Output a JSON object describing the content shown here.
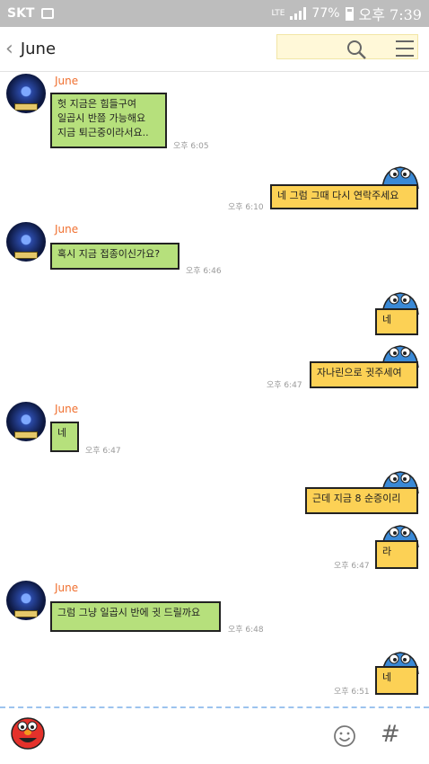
{
  "status_bar": {
    "carrier": "SKT",
    "network": "LTE",
    "battery": "77%",
    "time": "오후 7:39"
  },
  "header": {
    "back_icon": "chevron-left-icon",
    "title": "June",
    "search_icon": "search-icon",
    "menu_icon": "hamburger-menu-icon"
  },
  "messages": [
    {
      "sender": "June",
      "text": "헛 지금은 힘들구여\n일곱시 반쯤 가능해요\n지금 퇴근중이라서요..",
      "time": "오후 6:05"
    },
    {
      "text": "네 그럼 그때 다시 연락주세요",
      "time": "오후 6:10"
    },
    {
      "sender": "June",
      "text": "혹시 지금 접종이신가요?",
      "time": "오후 6:46"
    },
    {
      "text": "네",
      "time": ""
    },
    {
      "text": "자나린으로 귓주세여",
      "time": "오후 6:47"
    },
    {
      "sender": "June",
      "text": "네",
      "time": "오후 6:47"
    },
    {
      "text": "근데 지금 8 순증이리",
      "time": ""
    },
    {
      "text": "라",
      "time": "오후 6:47"
    },
    {
      "sender": "June",
      "text": "그럼 그냥 일곱시 반에 귓 드릴까요",
      "time": "오후 6:48"
    },
    {
      "text": "네",
      "time": "오후 6:51"
    }
  ],
  "colors": {
    "incoming_bubble": "#b6e07c",
    "outgoing_bubble": "#fcd155",
    "sender_name": "#f07030",
    "input_divider": "#9cc3ee"
  },
  "bottom_bar": {
    "sticker_icon": "elmo-icon",
    "emoji_icon": "smiley-icon",
    "hash": "#"
  }
}
